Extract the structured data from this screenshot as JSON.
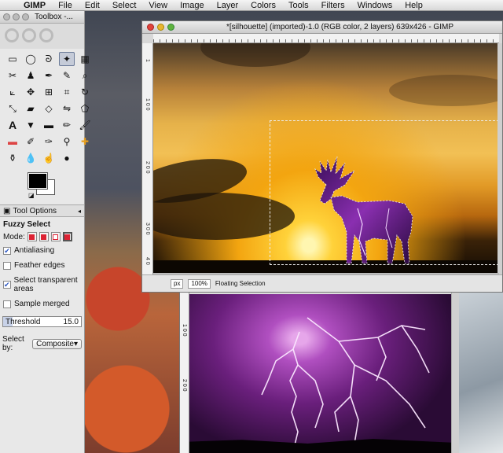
{
  "menubar": {
    "app": "GIMP",
    "items": [
      "File",
      "Edit",
      "Select",
      "View",
      "Image",
      "Layer",
      "Colors",
      "Tools",
      "Filters",
      "Windows",
      "Help"
    ]
  },
  "toolbox": {
    "title": "Toolbox -...",
    "active_tool": "fuzzy-select",
    "tab_label": "Tool Options",
    "options_title": "Fuzzy Select",
    "mode_label": "Mode:",
    "antialiasing": {
      "label": "Antialiasing",
      "checked": true
    },
    "feather": {
      "label": "Feather edges",
      "checked": false
    },
    "select_transparent": {
      "label": "Select transparent areas",
      "checked": true
    },
    "sample_merged": {
      "label": "Sample merged",
      "checked": false
    },
    "threshold": {
      "label": "Threshold",
      "value": "15.0"
    },
    "select_by": {
      "label": "Select by:",
      "value": "Composite"
    },
    "colors": {
      "foreground": "#000000",
      "background": "#ffffff"
    }
  },
  "main_window": {
    "title": "*[silhouette] (imported)-1.0 (RGB color, 2 layers) 639x426 - GIMP",
    "ruler_left_labels": [
      "1",
      "1 0 0",
      "2 0 0",
      "3 0 0",
      "4 0"
    ],
    "status": {
      "unit": "px",
      "zoom": "100%",
      "message": "Floating Selection"
    }
  },
  "second_window": {
    "ruler_left_labels": [
      "1 0 0",
      "2 0 0"
    ]
  }
}
